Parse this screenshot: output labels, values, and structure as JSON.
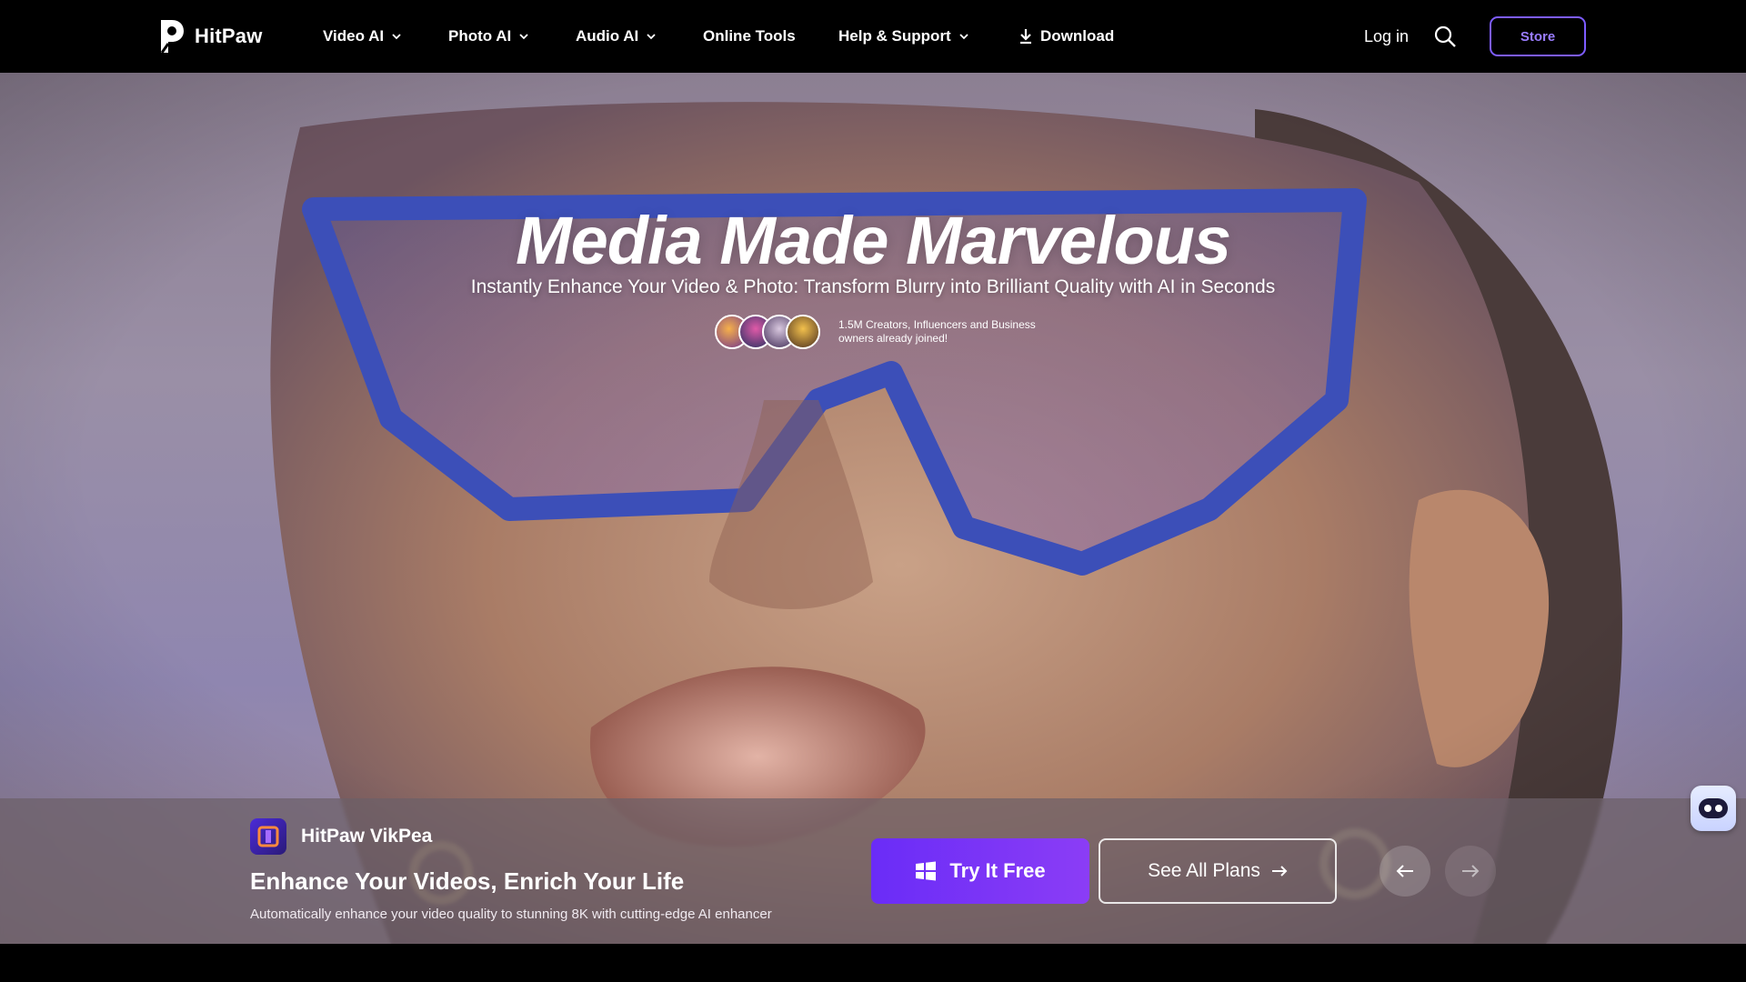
{
  "nav": {
    "brand": "HitPaw",
    "items": [
      {
        "label": "Video AI",
        "has_dropdown": true
      },
      {
        "label": "Photo AI",
        "has_dropdown": true
      },
      {
        "label": "Audio AI",
        "has_dropdown": true
      },
      {
        "label": "Online Tools",
        "has_dropdown": false
      },
      {
        "label": "Help & Support",
        "has_dropdown": true
      },
      {
        "label": "Download",
        "has_dropdown": false
      }
    ],
    "login": "Log in",
    "store": "Store"
  },
  "hero": {
    "title": "Media Made Marvelous",
    "subtitle": "Instantly Enhance Your Video & Photo: Transform Blurry into Brilliant Quality with AI in Seconds",
    "social_proof": "1.5M Creators, Influencers and Business owners already joined!"
  },
  "product": {
    "name": "HitPaw VikPea",
    "tagline": "Enhance Your Videos, Enrich Your Life",
    "description": "Automatically enhance your video quality to stunning 8K with cutting-edge AI enhancer",
    "try_label": "Try It Free",
    "plans_label": "See All Plans"
  },
  "colors": {
    "accent": "#7d5cff",
    "cta_start": "#6a2cf7",
    "cta_end": "#8b3df6"
  },
  "icons": [
    "hitpaw-logo-icon",
    "chevron-down-icon",
    "download-icon",
    "search-icon",
    "vikpea-icon",
    "windows-icon",
    "arrow-right-icon",
    "arrow-left-icon",
    "robot-chat-icon"
  ]
}
